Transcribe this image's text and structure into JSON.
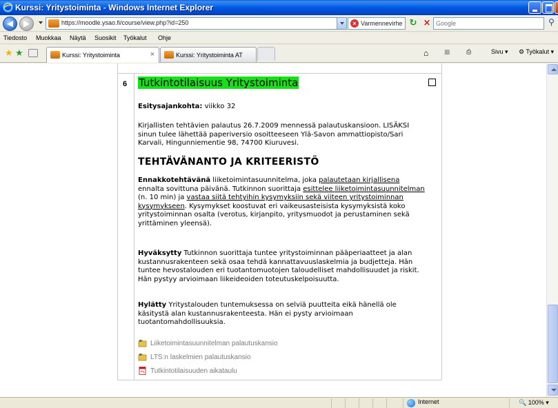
{
  "window": {
    "title": "Kurssi: Yritystoiminta - Windows Internet Explorer"
  },
  "address_bar": {
    "url": "https://moodle.ysao.fi/course/view.php?id=250",
    "cert_warning": "Varmennevirhe",
    "search_placeholder": "Google"
  },
  "menu": {
    "items": [
      "Tiedosto",
      "Muokkaa",
      "Näytä",
      "Suosikit",
      "Työkalut",
      "Ohje"
    ]
  },
  "tabs": [
    {
      "label": "Kurssi: Yritystoiminta",
      "active": true
    },
    {
      "label": "Kurssi: Yritystoiminta AT",
      "active": false
    }
  ],
  "command_bar": {
    "page_label": "Sivu",
    "tools_label": "Työkalut"
  },
  "section": {
    "number": "6",
    "title": "Tutkintotilaisuus Yritystoiminta",
    "schedule_label": "Esitysajankohta:",
    "schedule_value": " viikko 32",
    "submission_text": "Kirjallisten tehtävien palautus 26.7.2009 mennessä palautuskansioon. LISÄKSI sinun tulee lähettää paperiversio osoitteeseen Ylä-Savon ammattiopisto/Sari Karvali, Hingunniementie 98, 74700 Kiuruvesi.",
    "criteria_heading": "TEHTÄVÄNANTO JA KRITEERISTÖ",
    "pre_task": {
      "label": "Ennakkotehtävänä",
      "t1": " liiketoimintasuunnitelma, joka ",
      "u1": "palautetaan kirjallisena",
      "t2": " ennalta sovittuna päivänä. Tutkinnon suorittaja ",
      "u2": "esittelee liiketoimintasuunnitelman",
      "t3": " (n. 10 min) ja ",
      "u3": "vastaa siitä tehtyihin kysymyksiin sekä viiteen yritystoiminnan kysymykseen",
      "t4": ". Kysymykset koostuvat eri vaikeusasteisista kysymyksistä koko yritystoiminnan osalta (verotus, kirjanpito, yritysmuodot ja perustaminen sekä yrittäminen yleensä)."
    },
    "accepted": {
      "label": "Hyväksytty",
      "text": " Tutkinnon suorittaja tuntee yritystoiminnan pääperiaatteet ja alan kustannusrakenteen sekä osaa tehdä kannattavuuslaskelmia ja budjetteja. Hän tuntee hevostalouden eri tuotantomuotojen taloudelliset mahdollisuudet ja riskit. Hän pystyy arvioimaan liikeideoiden toteutuskelpoisuutta."
    },
    "rejected": {
      "label": "Hylätty",
      "text": " Yritystalouden tuntemuksessa on selviä puutteita eikä hänellä ole käsitystä alan kustannusrakenteesta. Hän ei pysty arvioimaan tuotantomahdollisuuksia."
    },
    "resources": [
      {
        "label": "Liiketoimintasuunnitelman palautuskansio",
        "icon": "folder-icon"
      },
      {
        "label": "LTS:n laskelmien palautuskansio",
        "icon": "folder-icon"
      },
      {
        "label": "Tutkintotilaisuuden aikataulu",
        "icon": "pdf-icon"
      }
    ]
  },
  "status_bar": {
    "zone": "Internet",
    "zoom": "100%"
  },
  "colors": {
    "heading_highlight": "#18e018",
    "titlebar": "#0058e6"
  }
}
